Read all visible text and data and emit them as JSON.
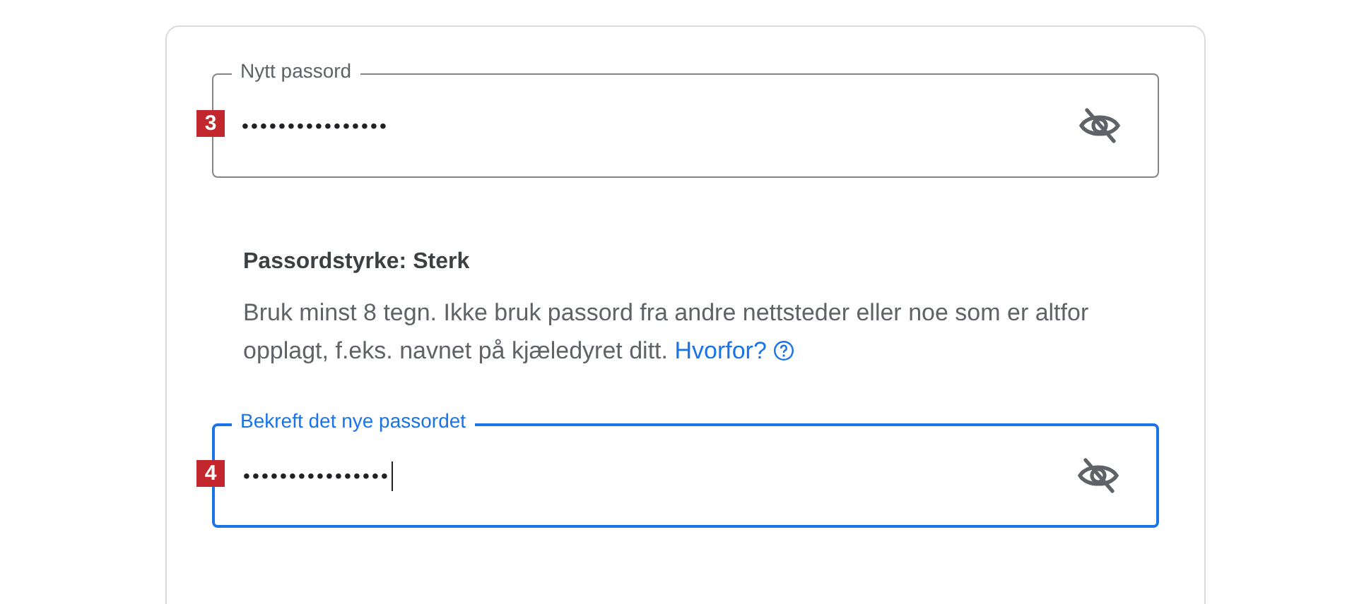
{
  "fields": [
    {
      "label": "Nytt passord",
      "value": "••••••••••••••••",
      "badge": "3",
      "focused": false
    },
    {
      "label": "Bekreft det nye passordet",
      "value": "••••••••••••••••",
      "badge": "4",
      "focused": true
    }
  ],
  "strength": {
    "title": "Passordstyrke: Sterk",
    "hint": "Bruk minst 8 tegn. Ikke bruk passord fra andre nettsteder eller noe som er altfor opplagt, f.eks. navnet på kjæledyret ditt.",
    "link": "Hvorfor?"
  }
}
